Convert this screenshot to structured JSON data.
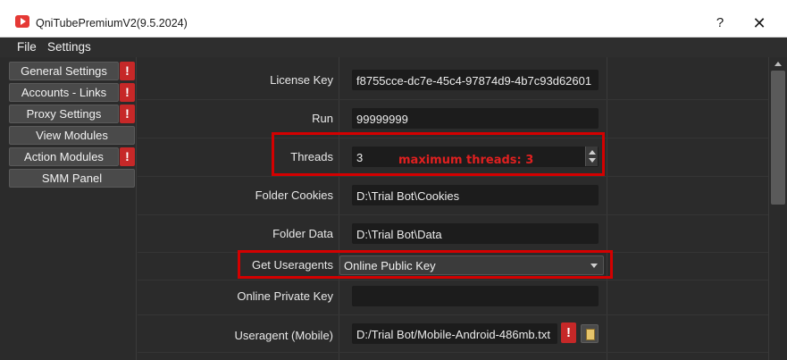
{
  "window": {
    "title": "QniTubePremiumV2(9.5.2024)",
    "help_label": "?",
    "close_label": "✕"
  },
  "menu": {
    "items": [
      {
        "label": "File"
      },
      {
        "label": "Settings"
      }
    ]
  },
  "sidebar": {
    "items": [
      {
        "label": "General Settings",
        "warning": true
      },
      {
        "label": "Accounts - Links",
        "warning": true
      },
      {
        "label": "Proxy Settings",
        "warning": true
      },
      {
        "label": "View Modules",
        "warning": false
      },
      {
        "label": "Action Modules",
        "warning": true
      },
      {
        "label": "SMM Panel",
        "warning": false
      }
    ],
    "warning_glyph": "!"
  },
  "form": {
    "license_key": {
      "label": "License Key",
      "value": "f8755cce-dc7e-45c4-97874d9-4b7c93d62601"
    },
    "run": {
      "label": "Run",
      "value": "99999999"
    },
    "threads": {
      "label": "Threads",
      "value": "3",
      "annotation": "maximum threads: 3"
    },
    "folder_cookies": {
      "label": "Folder Cookies",
      "value": "D:\\Trial Bot\\Cookies"
    },
    "folder_data": {
      "label": "Folder Data",
      "value": "D:\\Trial Bot\\Data"
    },
    "get_useragents": {
      "label": "Get Useragents",
      "selected": "Online Public Key"
    },
    "online_private_key": {
      "label": "Online Private Key",
      "value": ""
    },
    "useragent_mobile": {
      "label": "Useragent  (Mobile)",
      "value": "D:/Trial Bot/Mobile-Android-486mb.txt",
      "warning_glyph": "!"
    }
  },
  "colors": {
    "background": "#2b2b2b",
    "field": "#1c1c1c",
    "warning": "#c62828",
    "highlight": "#d40000"
  }
}
